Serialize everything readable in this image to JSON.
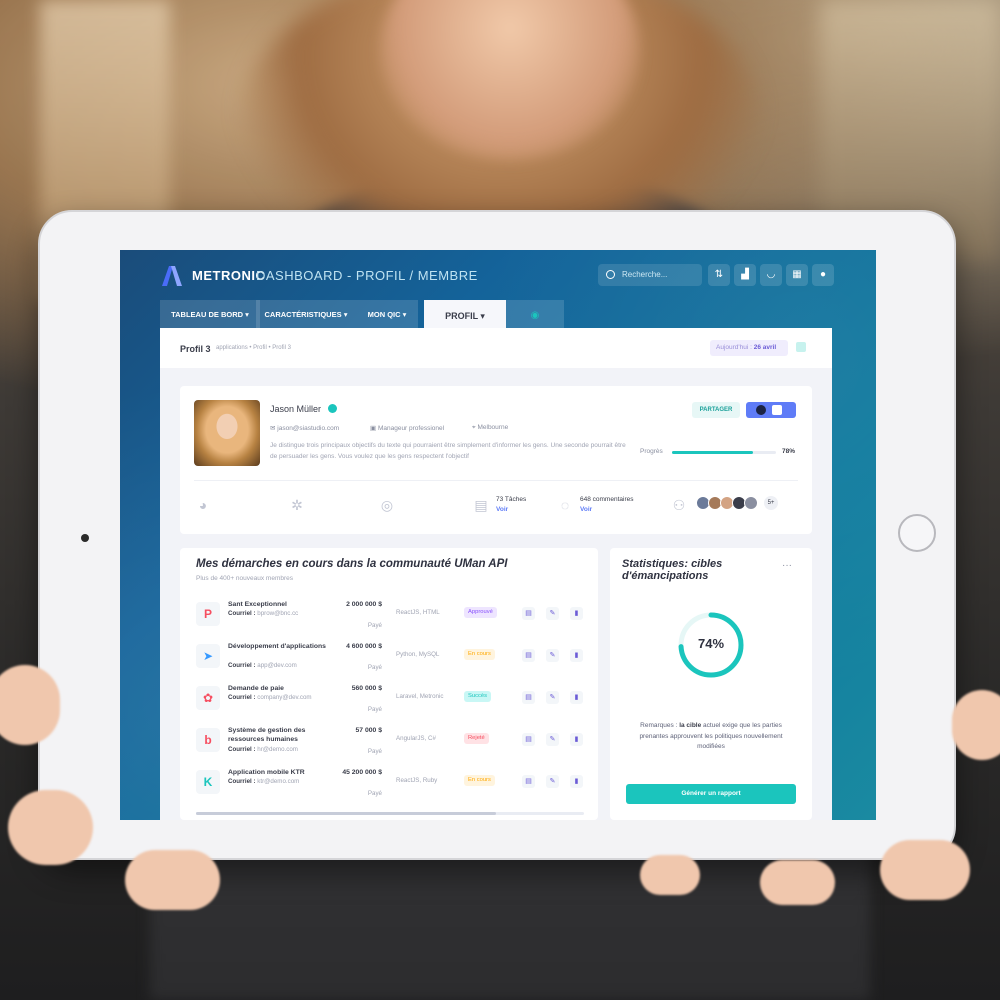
{
  "header": {
    "brand": "METRONIC",
    "title": "DASHBOARD - PROFIL / MEMBRE",
    "search_placeholder": "Recherche..."
  },
  "tabs": [
    {
      "label": "TABLEAU DE BORD"
    },
    {
      "label": "CARACTÉRISTIQUES"
    },
    {
      "label": "MON QIC"
    },
    {
      "label": "PROFIL"
    }
  ],
  "subheader": {
    "title": "Profil 3",
    "breadcrumb": "applications  •  Profil  •  Profil 3",
    "date_prefix": "Aujourd'hui :",
    "date_value": "26 avril"
  },
  "profile": {
    "name": "Jason Müller",
    "email": "jason@siastudio.com",
    "role": "Manageur professionel",
    "location": "Melbourne",
    "description": "Je distingue trois principaux objectifs du texte qui pourraient être simplement d'informer les gens. Une seconde pourrait être de persuader les gens. Vous voulez que les gens respectent l'objectif",
    "share_label": "PARTAGER",
    "progress_label": "Progrès",
    "progress_text": "78%",
    "progress_value": 0.78,
    "tasks_label": "73 Tâches",
    "tasks_link": "Voir",
    "comments_label": "648 commentaires",
    "comments_link": "Voir",
    "members_more": "5+"
  },
  "projects": {
    "title": "Mes démarches en cours dans la communauté UMan API",
    "subtitle": "Plus de 400+ nouveaux membres",
    "rows": [
      {
        "name": "Sant Exceptionnel",
        "mail_label": "Courriel :",
        "mail": "bprow@bnc.cc",
        "amount": "2 000 000 $",
        "paid": "Payé",
        "tech": "ReactJS, HTML",
        "status": "Approuvé",
        "icon": "P",
        "color": "#f64e60",
        "status_bg": "#eee5ff",
        "status_fg": "#8950fc"
      },
      {
        "name": "Développement d'applications",
        "mail_label": "Courriel :",
        "mail": "app@dev.com",
        "amount": "4 600 000 $",
        "paid": "Payé",
        "tech": "Python, MySQL",
        "status": "En cours",
        "icon": "➤",
        "color": "#3699ff",
        "status_bg": "#fff4de",
        "status_fg": "#ffa800"
      },
      {
        "name": "Demande de paie",
        "mail_label": "Courriel :",
        "mail": "company@dev.com",
        "amount": "560 000 $",
        "paid": "Payé",
        "tech": "Laravel, Metronic",
        "status": "Succès",
        "icon": "✿",
        "color": "#f64e60",
        "status_bg": "#c9f7f5",
        "status_fg": "#1bc5bd"
      },
      {
        "name": "Système de gestion des ressources humaines",
        "mail_label": "Courriel :",
        "mail": "hr@demo.com",
        "amount": "57 000 $",
        "paid": "Payé",
        "tech": "AngularJS, C#",
        "status": "Rejeté",
        "icon": "b",
        "color": "#f64e60",
        "status_bg": "#ffe2e5",
        "status_fg": "#f64e60"
      },
      {
        "name": "Application mobile KTR",
        "mail_label": "Courriel :",
        "mail": "ktr@demo.com",
        "amount": "45 200 000 $",
        "paid": "Payé",
        "tech": "ReactJS, Ruby",
        "status": "En cours",
        "icon": "K",
        "color": "#1bc5bd",
        "status_bg": "#fff4de",
        "status_fg": "#ffa800"
      }
    ]
  },
  "stats": {
    "title": "Statistiques: cibles d'émancipations",
    "more": "···",
    "value_text": "74%",
    "value": 0.74,
    "note_prefix": "Remarques :",
    "note_highlight": "la cible",
    "note_rest": "actuel exige que les parties prenantes approuvent les politiques nouvellement modifiées",
    "button": "Générer un rapport"
  },
  "colors": {
    "accent": "#1bc5bd",
    "primary": "#5f7cf7",
    "header_bg": "#14639a"
  }
}
